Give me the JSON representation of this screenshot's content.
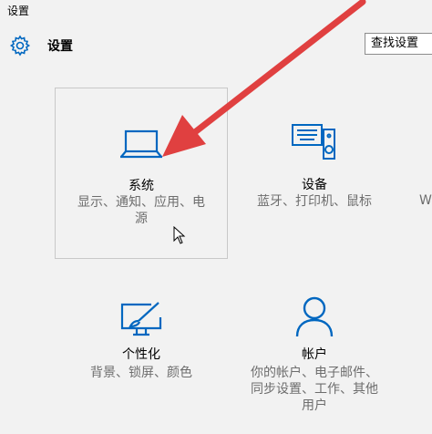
{
  "window": {
    "title": "设置"
  },
  "header": {
    "title": "设置",
    "settings_icon": "gear-icon"
  },
  "search": {
    "label": "查找设置"
  },
  "tiles": [
    {
      "title": "系统",
      "desc_lines": [
        "显示、通知、应用、电",
        "源"
      ],
      "icon": "laptop-icon",
      "selected": true
    },
    {
      "title": "设备",
      "desc_lines": [
        "蓝牙、打印机、鼠标"
      ],
      "icon": "devices-icon"
    },
    {
      "title": "个性化",
      "desc_lines": [
        "背景、锁屏、颜色"
      ],
      "icon": "personalization-icon"
    },
    {
      "title": "帐户",
      "desc_lines": [
        "你的帐户、电子邮件、",
        "同步设置、工作、其他",
        "用户"
      ],
      "icon": "person-icon"
    }
  ],
  "cutoff_text": "W",
  "colors": {
    "accent": "#0067c0",
    "annotation_arrow": "#e04040",
    "background": "#f2f2f2"
  }
}
